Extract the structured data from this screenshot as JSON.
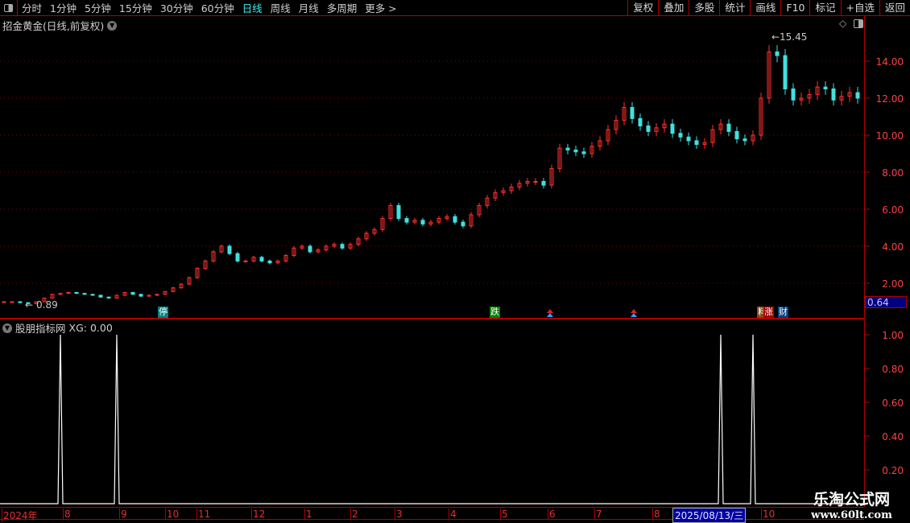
{
  "toolbar": {
    "periods": [
      "分时",
      "1分钟",
      "5分钟",
      "15分钟",
      "30分钟",
      "60分钟",
      "日线",
      "周线",
      "月线",
      "多周期",
      "更多 >"
    ],
    "active": "日线",
    "buttons": [
      "复权",
      "叠加",
      "多股",
      "统计",
      "画线",
      "F10",
      "标记",
      "+自选",
      "返回"
    ]
  },
  "main": {
    "title": "招金黄金(日线,前复权)",
    "last_price": "0.64",
    "max_label": "15.45",
    "min_label": "0.89"
  },
  "indicator": {
    "title": "股朋指标网",
    "value_label": "XG: 0.00"
  },
  "markers": [
    {
      "text": "停",
      "color": "#008080"
    },
    {
      "text": "跌",
      "color": "#008000"
    },
    {
      "text": "料",
      "color": "#8b4513"
    },
    {
      "text": "涨",
      "color": "#a00000"
    },
    {
      "text": "财",
      "color": "#004080"
    }
  ],
  "date_axis": {
    "labels": [
      "2024年",
      "8",
      "9",
      "10",
      "11",
      "12",
      "1",
      "2",
      "3",
      "4",
      "5",
      "6",
      "7",
      "8",
      "10"
    ],
    "cursor": "2025/08/13/三"
  },
  "watermark": {
    "line1": "乐淘公式网",
    "line2": "www.60lt.com"
  },
  "colors": {
    "up": "#ff3030",
    "down": "#40e0e0",
    "axis": "#b00000",
    "active": "#3cf0f0"
  },
  "chart_data": [
    {
      "type": "candlestick",
      "yticks": [
        "2.00",
        "4.00",
        "6.00",
        "8.00",
        "10.00",
        "12.00",
        "14.00"
      ],
      "ylim": [
        0,
        16
      ],
      "grid": true,
      "close": [
        1.0,
        1.0,
        0.95,
        0.9,
        1.0,
        1.2,
        1.4,
        1.45,
        1.5,
        1.45,
        1.4,
        1.35,
        1.25,
        1.2,
        1.35,
        1.5,
        1.4,
        1.3,
        1.35,
        1.4,
        1.55,
        1.75,
        1.95,
        2.3,
        2.8,
        3.2,
        3.7,
        4.0,
        3.6,
        3.2,
        3.2,
        3.4,
        3.2,
        3.1,
        3.2,
        3.5,
        3.9,
        4.0,
        3.7,
        3.8,
        4.0,
        4.1,
        3.9,
        4.1,
        4.4,
        4.7,
        4.9,
        5.5,
        6.2,
        5.5,
        5.3,
        5.4,
        5.2,
        5.3,
        5.5,
        5.6,
        5.3,
        5.1,
        5.7,
        6.2,
        6.6,
        6.9,
        7.0,
        7.2,
        7.4,
        7.5,
        7.5,
        7.3,
        8.2,
        9.3,
        9.2,
        9.1,
        9.0,
        9.4,
        9.7,
        10.3,
        10.8,
        11.5,
        10.9,
        10.5,
        10.2,
        10.4,
        10.6,
        10.1,
        9.9,
        9.7,
        9.5,
        9.6,
        10.3,
        10.6,
        10.2,
        9.8,
        9.7,
        10.0,
        12.0,
        14.5,
        14.3,
        12.5,
        11.9,
        12.0,
        12.2,
        12.6,
        12.5,
        11.9,
        12.1,
        12.3,
        12.0
      ]
    },
    {
      "type": "line",
      "series": [
        {
          "name": "XG",
          "signal_indices": [
            7,
            14,
            89,
            93
          ]
        }
      ],
      "yticks": [
        "0.20",
        "0.40",
        "0.60",
        "0.80",
        "1.00"
      ],
      "ylim": [
        0,
        1
      ]
    }
  ]
}
